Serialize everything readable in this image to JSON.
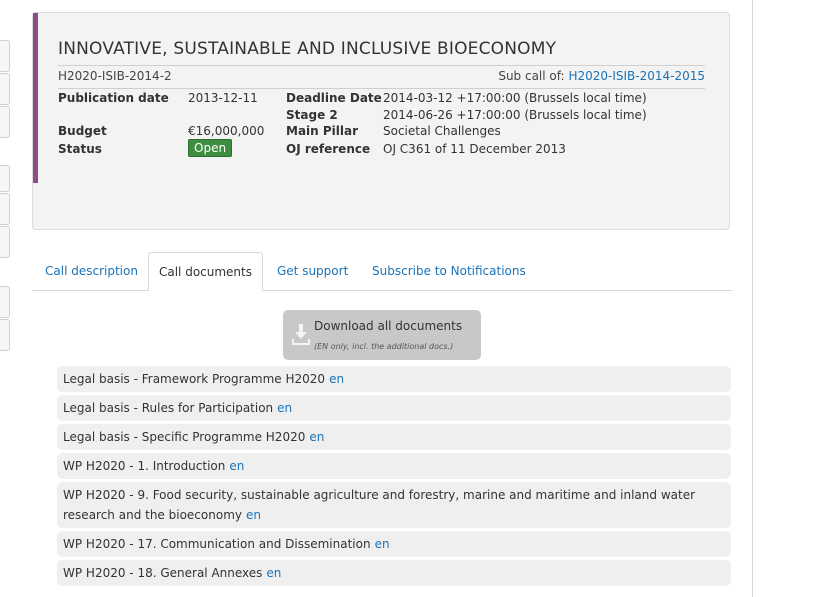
{
  "call": {
    "title": "INNOVATIVE, SUSTAINABLE AND INCLUSIVE BIOECONOMY",
    "identifier": "H2020-ISIB-2014-2",
    "subcall_label": "Sub call of:",
    "subcall_link": "H2020-ISIB-2014-2015",
    "publication_date_label": "Publication date",
    "publication_date": "2013-12-11",
    "budget_label": "Budget",
    "budget": "€16,000,000",
    "status_label": "Status",
    "status": "Open",
    "deadline_label": "Deadline Date",
    "deadline": "2014-03-12 +17:00:00 (Brussels local time)",
    "stage2_label": "Stage 2",
    "stage2": "2014-06-26 +17:00:00 (Brussels local time)",
    "pillar_label": "Main Pillar",
    "pillar": "Societal Challenges",
    "oj_label": "OJ reference",
    "oj_link": "OJ C361 of 11 December 2013"
  },
  "tabs": [
    {
      "label": "Call description"
    },
    {
      "label": "Call documents"
    },
    {
      "label": "Get support"
    },
    {
      "label": "Subscribe to Notifications"
    }
  ],
  "download": {
    "label": "Download all documents",
    "note": "(EN only, incl. the additional docs.)"
  },
  "documents": [
    {
      "text": "Legal basis - Framework Programme H2020",
      "lang": "en"
    },
    {
      "text": "Legal basis - Rules for Participation",
      "lang": "en"
    },
    {
      "text": "Legal basis - Specific Programme H2020",
      "lang": "en"
    },
    {
      "text": "WP H2020 - 1. Introduction",
      "lang": "en"
    },
    {
      "text": "WP H2020 - 9. Food security, sustainable agriculture and forestry, marine and maritime and inland water research and the bioeconomy",
      "lang": "en"
    },
    {
      "text": "WP H2020 - 17. Communication and Dissemination",
      "lang": "en"
    },
    {
      "text": "WP H2020 - 18. General Annexes",
      "lang": "en"
    }
  ],
  "colors": {
    "accent": "#8c4e84",
    "link": "#1a73b8",
    "status_open": "#3e8e41"
  }
}
